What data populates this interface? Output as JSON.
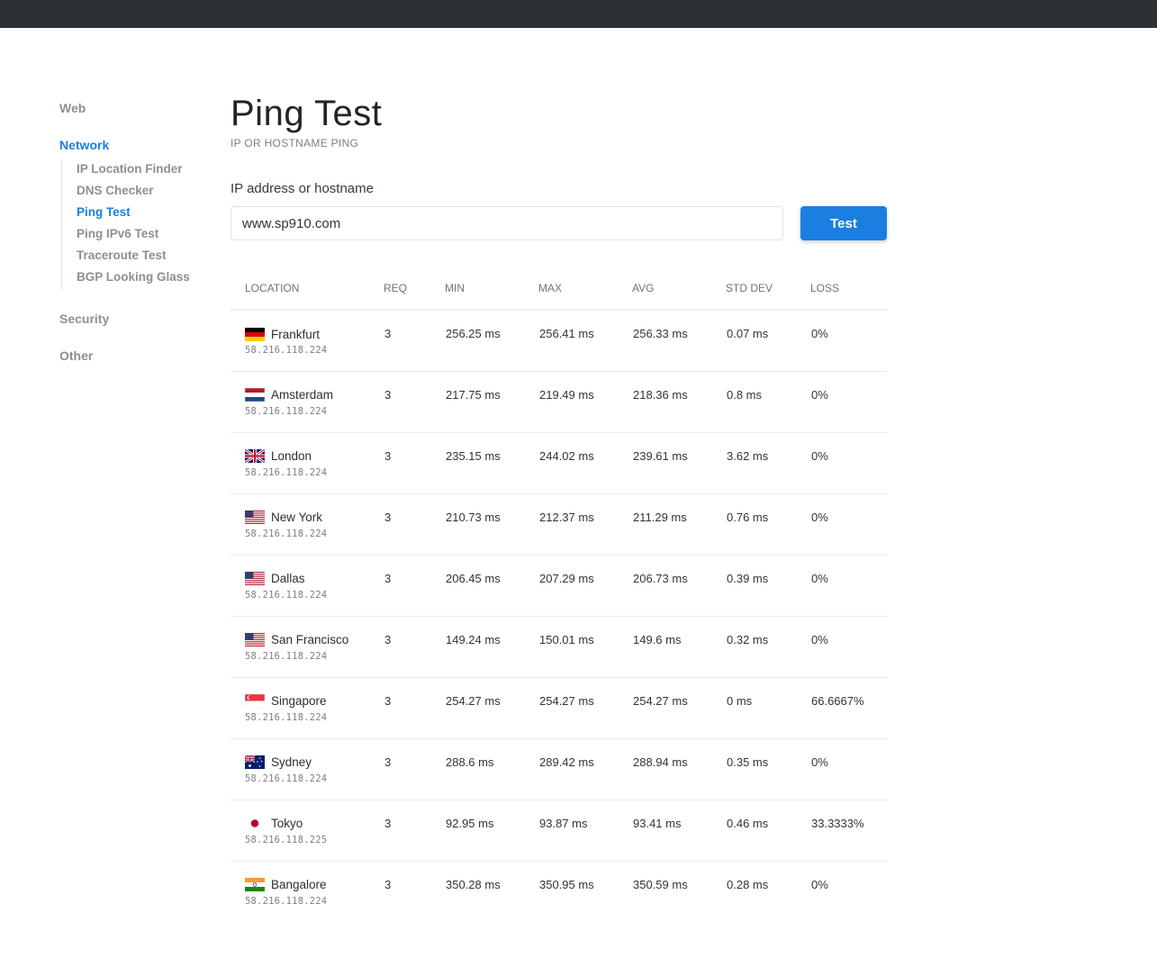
{
  "sidebar": {
    "groups": [
      {
        "label": "Web"
      },
      {
        "label": "Network",
        "items": [
          "IP Location Finder",
          "DNS Checker",
          "Ping Test",
          "Ping IPv6 Test",
          "Traceroute Test",
          "BGP Looking Glass"
        ]
      },
      {
        "label": "Security"
      },
      {
        "label": "Other"
      }
    ],
    "active_item": "Ping Test"
  },
  "page": {
    "title": "Ping Test",
    "subtitle": "IP OR HOSTNAME PING"
  },
  "form": {
    "label": "IP address or hostname",
    "value": "www.sp910.com",
    "button": "Test"
  },
  "table": {
    "headers": [
      "LOCATION",
      "REQ",
      "MIN",
      "MAX",
      "AVG",
      "STD DEV",
      "LOSS"
    ],
    "rows": [
      {
        "flag": "de",
        "city": "Frankfurt",
        "ip": "58.216.118.224",
        "req": "3",
        "min": "256.25 ms",
        "max": "256.41 ms",
        "avg": "256.33 ms",
        "std": "0.07 ms",
        "loss": "0%"
      },
      {
        "flag": "nl",
        "city": "Amsterdam",
        "ip": "58.216.118.224",
        "req": "3",
        "min": "217.75 ms",
        "max": "219.49 ms",
        "avg": "218.36 ms",
        "std": "0.8 ms",
        "loss": "0%"
      },
      {
        "flag": "gb",
        "city": "London",
        "ip": "58.216.118.224",
        "req": "3",
        "min": "235.15 ms",
        "max": "244.02 ms",
        "avg": "239.61 ms",
        "std": "3.62 ms",
        "loss": "0%"
      },
      {
        "flag": "us",
        "city": "New York",
        "ip": "58.216.118.224",
        "req": "3",
        "min": "210.73 ms",
        "max": "212.37 ms",
        "avg": "211.29 ms",
        "std": "0.76 ms",
        "loss": "0%"
      },
      {
        "flag": "us",
        "city": "Dallas",
        "ip": "58.216.118.224",
        "req": "3",
        "min": "206.45 ms",
        "max": "207.29 ms",
        "avg": "206.73 ms",
        "std": "0.39 ms",
        "loss": "0%"
      },
      {
        "flag": "us",
        "city": "San Francisco",
        "ip": "58.216.118.224",
        "req": "3",
        "min": "149.24 ms",
        "max": "150.01 ms",
        "avg": "149.6 ms",
        "std": "0.32 ms",
        "loss": "0%"
      },
      {
        "flag": "sg",
        "city": "Singapore",
        "ip": "58.216.118.224",
        "req": "3",
        "min": "254.27 ms",
        "max": "254.27 ms",
        "avg": "254.27 ms",
        "std": "0 ms",
        "loss": "66.6667%"
      },
      {
        "flag": "au",
        "city": "Sydney",
        "ip": "58.216.118.224",
        "req": "3",
        "min": "288.6 ms",
        "max": "289.42 ms",
        "avg": "288.94 ms",
        "std": "0.35 ms",
        "loss": "0%"
      },
      {
        "flag": "jp",
        "city": "Tokyo",
        "ip": "58.216.118.225",
        "req": "3",
        "min": "92.95 ms",
        "max": "93.87 ms",
        "avg": "93.41 ms",
        "std": "0.46 ms",
        "loss": "33.3333%"
      },
      {
        "flag": "in",
        "city": "Bangalore",
        "ip": "58.216.118.224",
        "req": "3",
        "min": "350.28 ms",
        "max": "350.95 ms",
        "avg": "350.59 ms",
        "std": "0.28 ms",
        "loss": "0%"
      }
    ]
  },
  "colors": {
    "accent": "#1a7fe0",
    "topbar": "#2d3134"
  }
}
